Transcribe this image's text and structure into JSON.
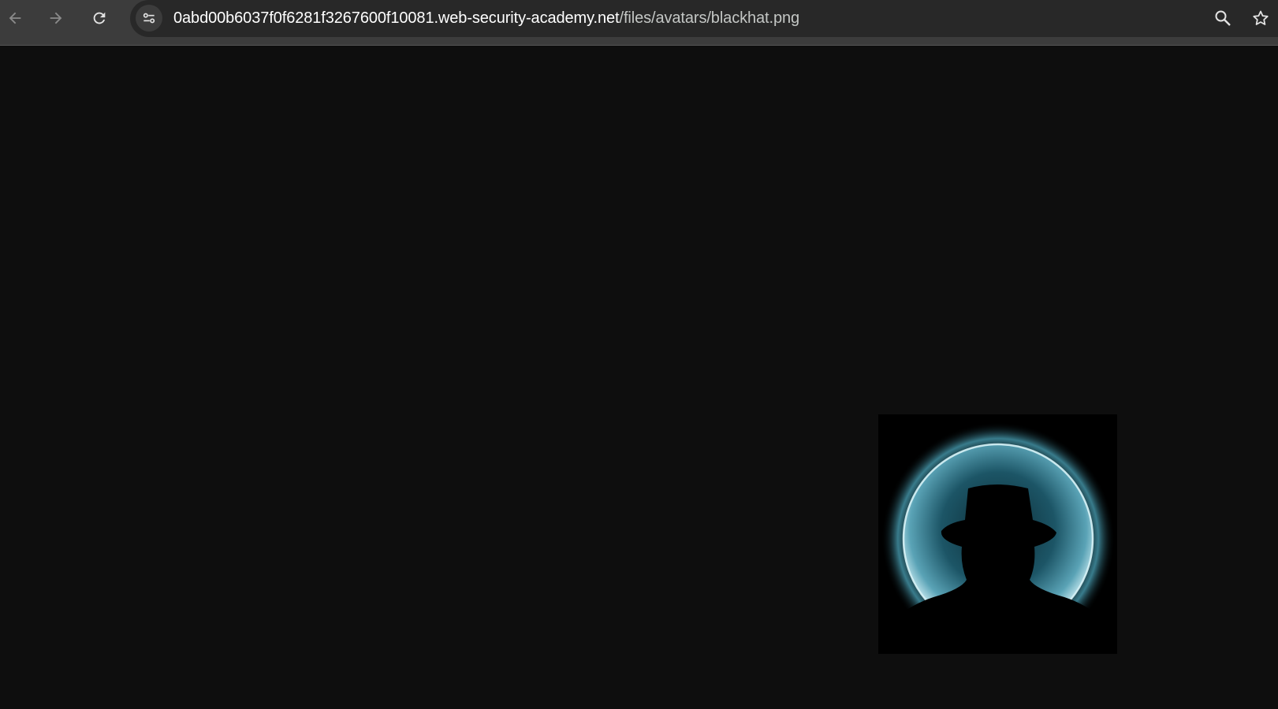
{
  "browser": {
    "back_icon": "arrow-left-icon",
    "forward_icon": "arrow-right-icon",
    "reload_icon": "reload-icon",
    "site_info_icon": "tune-icon",
    "url_host": "0abd00b6037f0f6281f3267600f10081.web-security-academy.net",
    "url_path": "/files/avatars/blackhat.png",
    "zoom_icon": "magnifier-icon",
    "bookmark_icon": "star-icon",
    "toolbar_color": "#3c3c3c",
    "omnibox_color": "#282828"
  },
  "page": {
    "background_color": "#0e0e0e",
    "image": {
      "file_name": "blackhat.png",
      "depicts": "silhouette-of-man-in-fedora-with-blue-glowing-moon-icon",
      "glow_color": "#7fbccc"
    }
  }
}
